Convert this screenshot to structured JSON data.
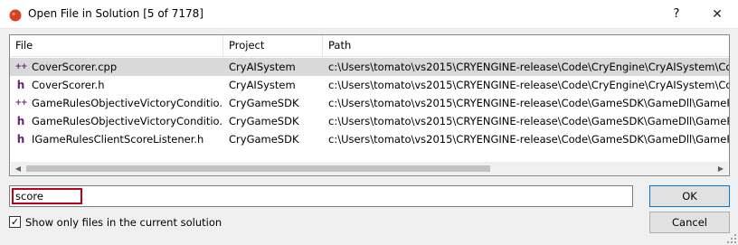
{
  "window": {
    "title": "Open File in Solution [5 of 7178]",
    "help_label": "?",
    "close_label": "✕"
  },
  "table": {
    "columns": [
      "File",
      "Project",
      "Path"
    ],
    "rows": [
      {
        "file": "CoverScorer.cpp",
        "project": "CryAISystem",
        "path": "c:\\Users\\tomato\\vs2015\\CRYENGINE-release\\Code\\CryEngine\\CryAISystem\\Cover\\",
        "icon": "cpp-file-icon",
        "glyph": "++"
      },
      {
        "file": "CoverScorer.h",
        "project": "CryAISystem",
        "path": "c:\\Users\\tomato\\vs2015\\CRYENGINE-release\\Code\\CryEngine\\CryAISystem\\Cover\\",
        "icon": "header-file-icon",
        "glyph": "h"
      },
      {
        "file": "GameRulesObjectiveVictoryConditio...",
        "project": "CryGameSDK",
        "path": "c:\\Users\\tomato\\vs2015\\CRYENGINE-release\\Code\\GameSDK\\GameDll\\GameRulesM",
        "icon": "cpp-file-icon",
        "glyph": "++"
      },
      {
        "file": "GameRulesObjectiveVictoryConditio...",
        "project": "CryGameSDK",
        "path": "c:\\Users\\tomato\\vs2015\\CRYENGINE-release\\Code\\GameSDK\\GameDll\\GameRulesM",
        "icon": "header-file-icon",
        "glyph": "h"
      },
      {
        "file": "IGameRulesClientScoreListener.h",
        "project": "CryGameSDK",
        "path": "c:\\Users\\tomato\\vs2015\\CRYENGINE-release\\Code\\GameSDK\\GameDll\\GameRulesM",
        "icon": "header-file-icon",
        "glyph": "h"
      }
    ],
    "selected_index": 0
  },
  "search": {
    "value": "score"
  },
  "options": {
    "show_only_solution_label": "Show only files in the current solution",
    "show_only_solution_checked": true
  },
  "buttons": {
    "ok_label": "OK",
    "cancel_label": "Cancel"
  },
  "colors": {
    "selection": "#d9d9d9",
    "file_icon": "#68217a",
    "search_highlight_border": "#c0001a",
    "default_button_border": "#0078d7"
  }
}
